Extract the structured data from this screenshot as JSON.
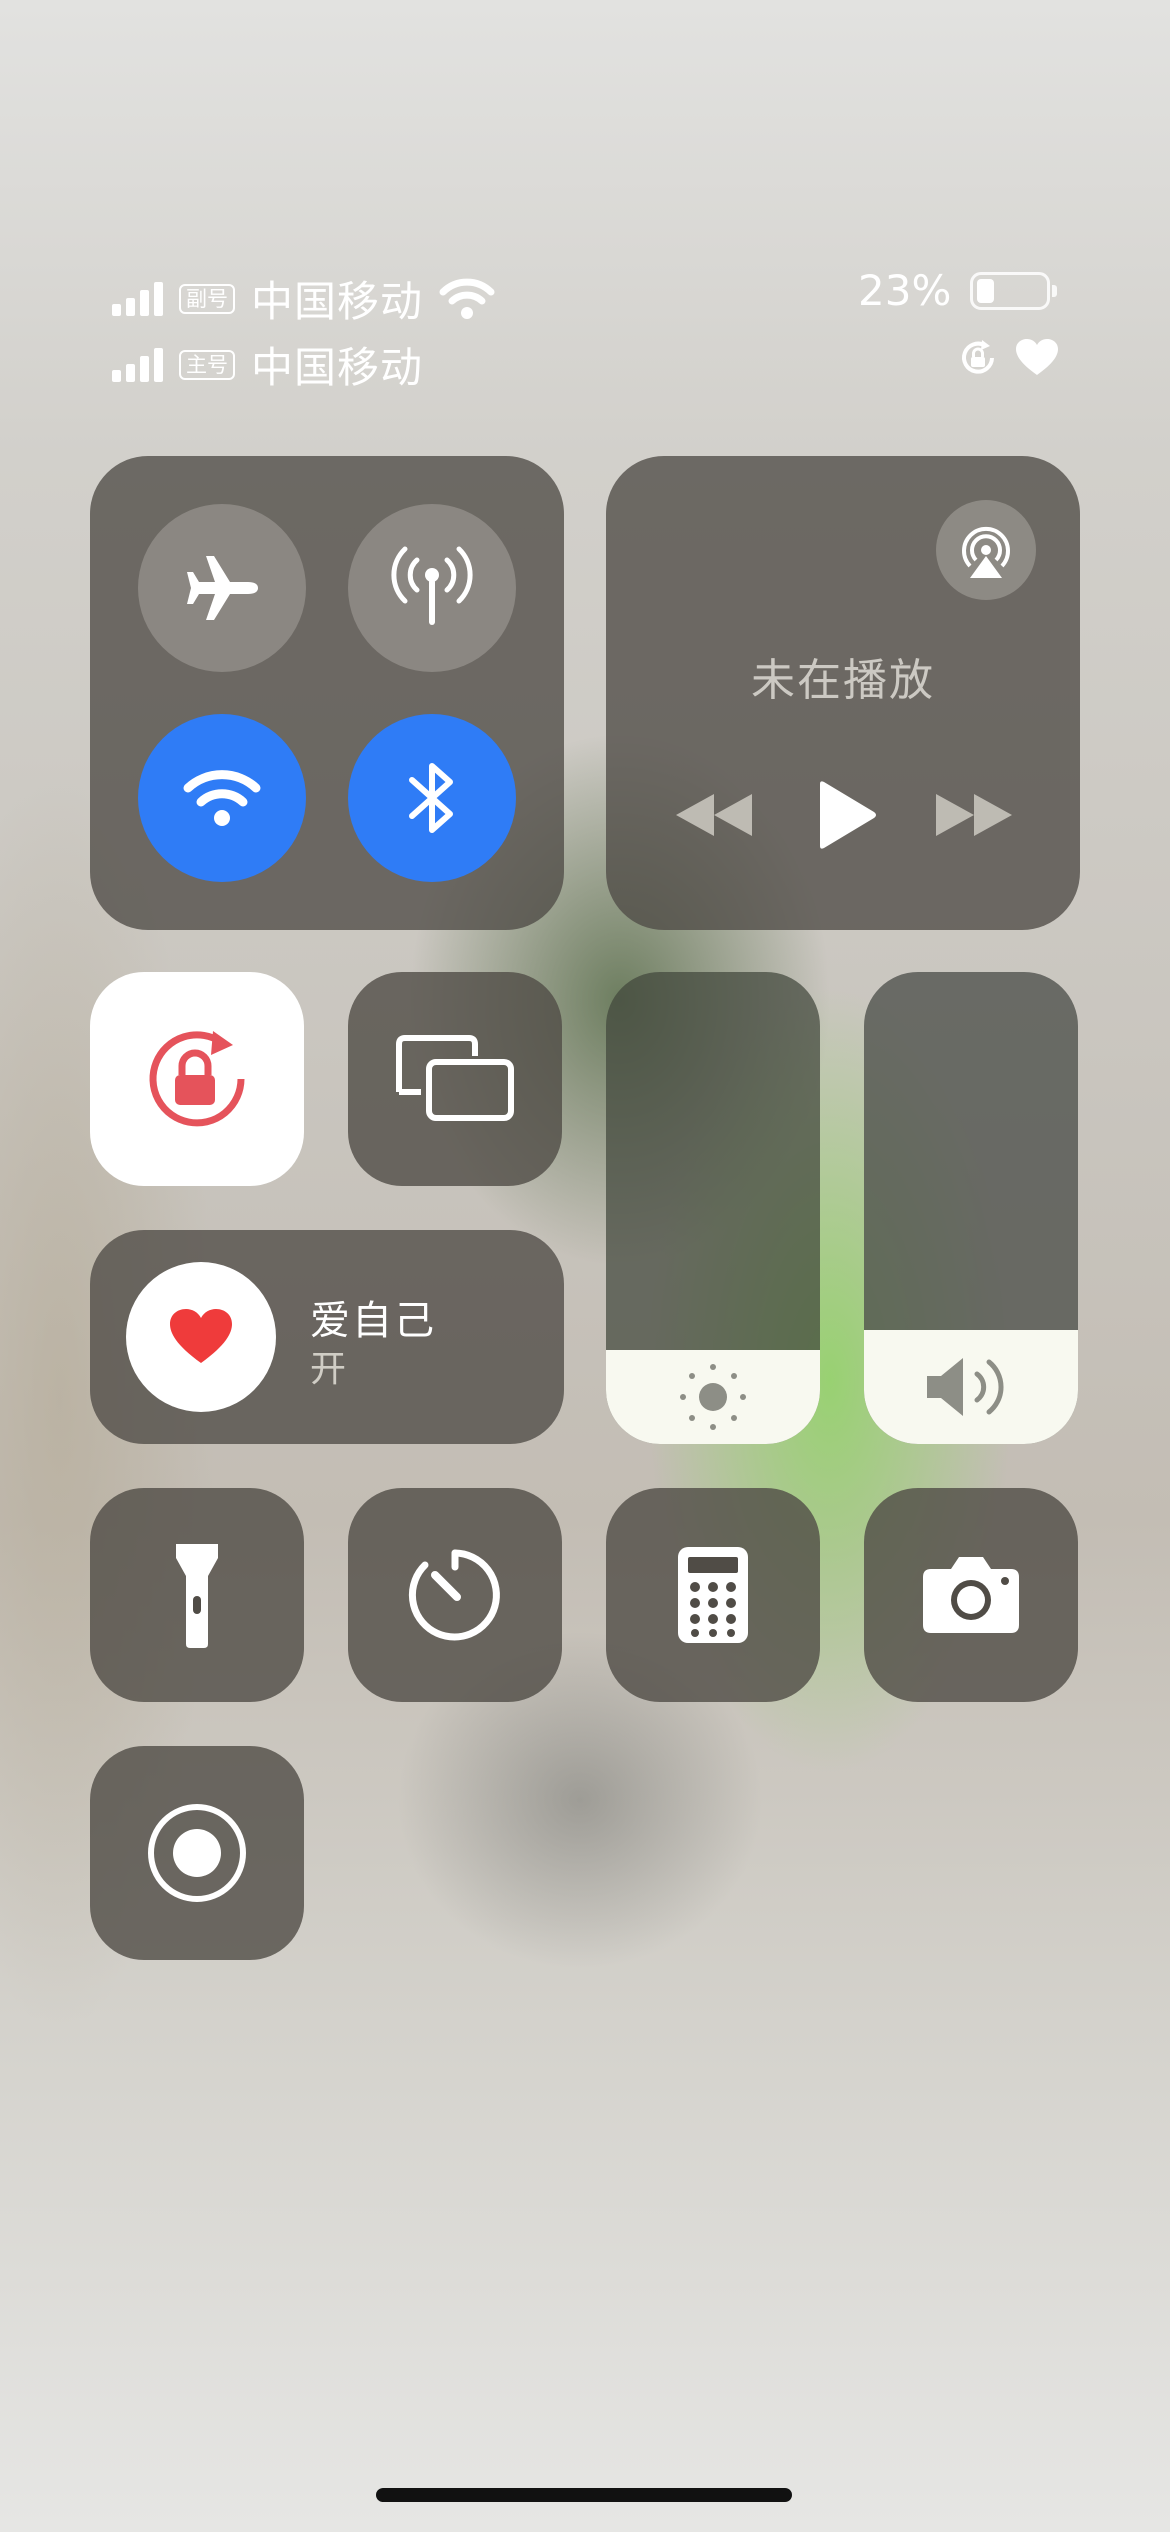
{
  "status": {
    "line1": {
      "tag": "副号",
      "carrier": "中国移动"
    },
    "line2": {
      "tag": "主号",
      "carrier": "中国移动"
    },
    "battery_percent": "23%",
    "battery_level": 0.23
  },
  "connectivity": {
    "airplane": {
      "icon": "airplane-icon",
      "on": false
    },
    "cellular": {
      "icon": "cellular-antenna-icon",
      "on": false
    },
    "wifi": {
      "icon": "wifi-icon",
      "on": true,
      "color": "#2f7cf6"
    },
    "bluetooth": {
      "icon": "bluetooth-icon",
      "on": true,
      "color": "#2f7cf6"
    }
  },
  "now_playing": {
    "title": "未在播放"
  },
  "focus": {
    "name": "爱自己",
    "state": "开",
    "icon_color": "#ef3b3b"
  },
  "brightness": {
    "level": 0.2
  },
  "volume": {
    "level": 0.24
  },
  "lock_icon_color": "#e5535b",
  "shortcuts": [
    "flashlight-icon",
    "timer-icon",
    "calculator-icon",
    "camera-icon",
    "screen-record-icon"
  ]
}
